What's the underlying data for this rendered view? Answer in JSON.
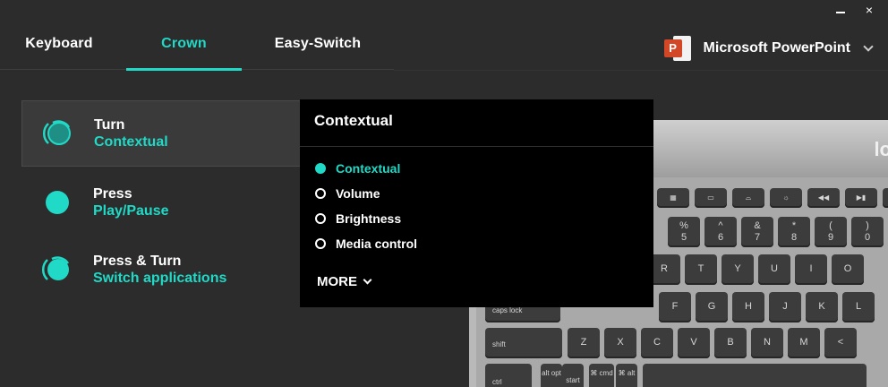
{
  "window": {
    "minimize_label": "",
    "close_label": "×"
  },
  "tabs": [
    {
      "label": "Keyboard"
    },
    {
      "label": "Crown"
    },
    {
      "label": "Easy-Switch"
    }
  ],
  "app_selector": {
    "icon_letter": "P",
    "name": "Microsoft PowerPoint"
  },
  "options": [
    {
      "title": "Turn",
      "subtitle": "Contextual"
    },
    {
      "title": "Press",
      "subtitle": "Play/Pause"
    },
    {
      "title": "Press & Turn",
      "subtitle": "Switch applications"
    }
  ],
  "dropdown": {
    "title": "Contextual",
    "items": [
      {
        "label": "Contextual"
      },
      {
        "label": "Volume"
      },
      {
        "label": "Brightness"
      },
      {
        "label": "Media control"
      }
    ],
    "more_label": "MORE"
  },
  "keyboard": {
    "logo": "lo",
    "num_row": [
      {
        "top": "%",
        "bottom": "5"
      },
      {
        "top": "^",
        "bottom": "6"
      },
      {
        "top": "&",
        "bottom": "7"
      },
      {
        "top": "*",
        "bottom": "8"
      },
      {
        "top": "(",
        "bottom": "9"
      },
      {
        "top": ")",
        "bottom": "0"
      }
    ],
    "row_q": [
      "R",
      "T",
      "Y",
      "U",
      "I",
      "O"
    ],
    "row_a": [
      "F",
      "G",
      "H",
      "J",
      "K",
      "L"
    ],
    "row_z": [
      "Z",
      "X",
      "C",
      "V",
      "B",
      "N",
      "M",
      "<"
    ],
    "shift_label": "shift",
    "ctrl_label": "ctrl",
    "alt_opt_label": "alt opt",
    "start_label": "start",
    "cmd_label": "⌘ cmd",
    "alt_label": "⌘ alt",
    "caps_label": "caps lock"
  }
}
